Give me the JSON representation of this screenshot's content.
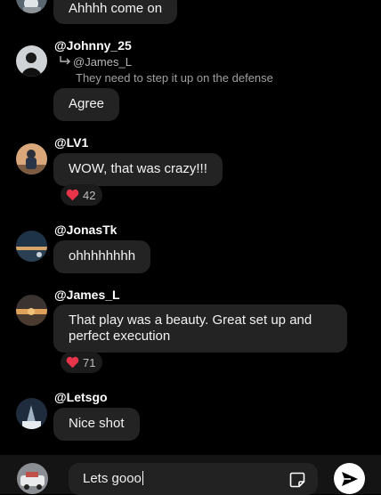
{
  "messages": [
    {
      "id": "m0",
      "text": "Ahhhh come on"
    },
    {
      "id": "m1",
      "username": "@Johnny_25",
      "reply_to": "@James_L",
      "reply_text": "They need to step it up on the defense",
      "text": "Agree"
    },
    {
      "id": "m2",
      "username": "@LV1",
      "text": "WOW, that was crazy!!!",
      "reaction": {
        "icon": "heart-icon",
        "count": "42"
      }
    },
    {
      "id": "m3",
      "username": "@JonasTk",
      "text": "ohhhhhhhh"
    },
    {
      "id": "m4",
      "username": "@James_L",
      "text": "That play was a beauty. Great set up and perfect execution",
      "reaction": {
        "icon": "heart-icon",
        "count": "71"
      }
    },
    {
      "id": "m5",
      "username": "@Letsgo",
      "text": "Nice shot"
    }
  ],
  "composer": {
    "input_value": "Lets gooo",
    "sticker_icon": "sticker-icon",
    "send_icon": "send-icon"
  },
  "colors": {
    "background": "#000000",
    "bubble": "#232323",
    "composer_bar": "#141414",
    "heart": "#e8344a"
  }
}
